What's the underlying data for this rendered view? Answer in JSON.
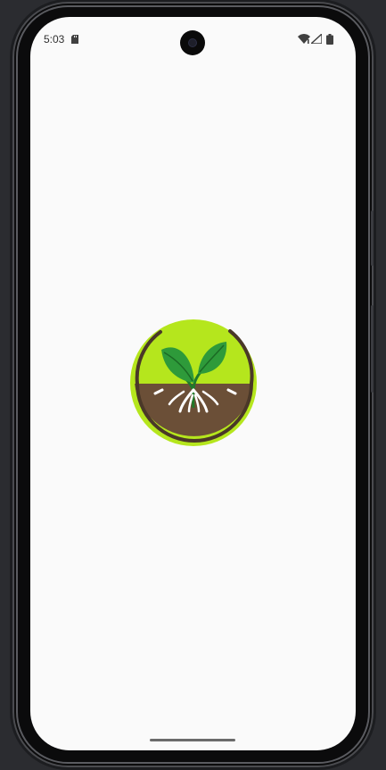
{
  "status_bar": {
    "time": "5:03",
    "icons": [
      "sd-card-icon",
      "wifi-icon",
      "cellular-signal-icon",
      "battery-icon"
    ]
  },
  "splash": {
    "logo": "plant-seedling-with-roots-logo"
  },
  "colors": {
    "screen_background": "#fafafa",
    "logo_green": "#b5e61d",
    "logo_soil": "#6b4f37",
    "leaf_green": "#2e9a3a"
  }
}
